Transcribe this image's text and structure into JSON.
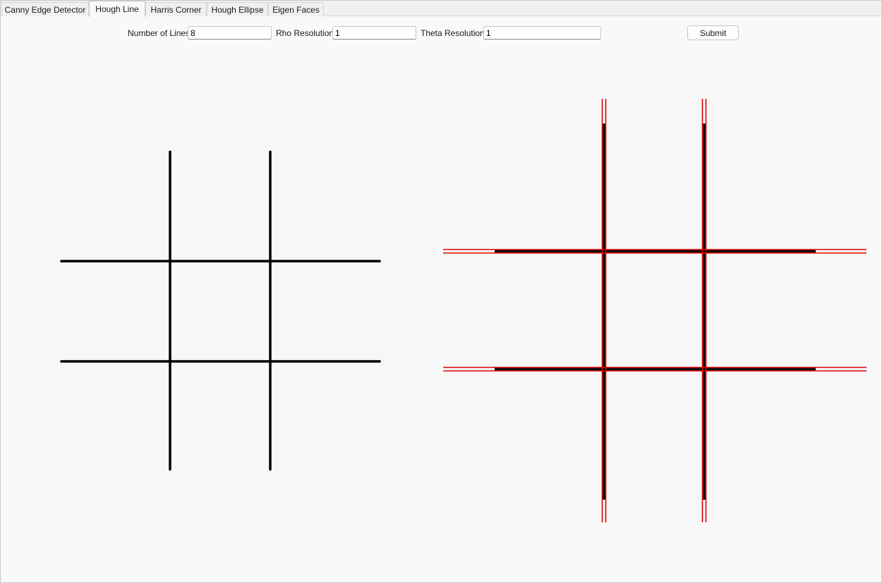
{
  "tabs": [
    {
      "label": "Canny Edge Detector",
      "active": false
    },
    {
      "label": "Hough Line",
      "active": true
    },
    {
      "label": "Harris Corner",
      "active": false
    },
    {
      "label": "Hough Ellipse",
      "active": false
    },
    {
      "label": "Eigen Faces",
      "active": false
    }
  ],
  "params": {
    "num_lines_label": "Number of Lines:",
    "num_lines_value": "8",
    "rho_label": "Rho Resolution:",
    "rho_value": "1",
    "theta_label": "Theta Resolution:",
    "theta_value": "1"
  },
  "toolbar": {
    "submit_label": "Submit"
  },
  "colors": {
    "detected_line": "#e00000",
    "input_stroke": "#000000",
    "panel_bg": "#f7f7f7"
  }
}
